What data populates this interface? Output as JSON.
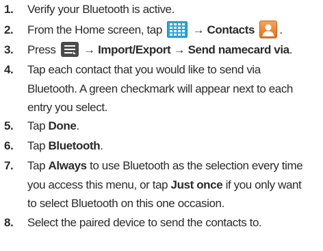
{
  "steps": [
    {
      "number": "1.",
      "text": "Verify your Bluetooth is active."
    },
    {
      "number": "2.",
      "prefix": "From the Home screen, tap",
      "arrow": "→",
      "bold": "Contacts",
      "suffix": ".",
      "icons": [
        "apps-grid-icon",
        "contacts-person-icon"
      ]
    },
    {
      "number": "3.",
      "prefix": "Press",
      "arrow1": "→",
      "bold1": "Import/Export",
      "arrow2": "→",
      "bold2": "Send namecard via",
      "suffix": ".",
      "icons": [
        "menu-icon"
      ]
    },
    {
      "number": "4.",
      "lines": [
        "Tap each contact that you would like to send via",
        "Bluetooth. A green checkmark will appear next to each",
        "entry you select."
      ]
    },
    {
      "number": "5.",
      "prefix": "Tap",
      "bold": "Done",
      "suffix": "."
    },
    {
      "number": "6.",
      "prefix": "Tap",
      "bold": "Bluetooth",
      "suffix": "."
    },
    {
      "number": "7.",
      "line1_prefix": "Tap",
      "line1_bold": "Always",
      "line1_suffix": "to use Bluetooth as the selection every time",
      "line2_prefix": "you access this menu, or tap",
      "line2_bold": "Just once",
      "line2_suffix": "if you only want",
      "line3": "to select Bluetooth on this one occasion."
    },
    {
      "number": "8.",
      "text": "Select the paired device to send the contacts to."
    }
  ],
  "colors": {
    "text": "#2a2a2a",
    "apps_icon": "#2aa5d8",
    "contacts_icon": "#e2701f",
    "menu_icon": "#4a4a4a"
  }
}
